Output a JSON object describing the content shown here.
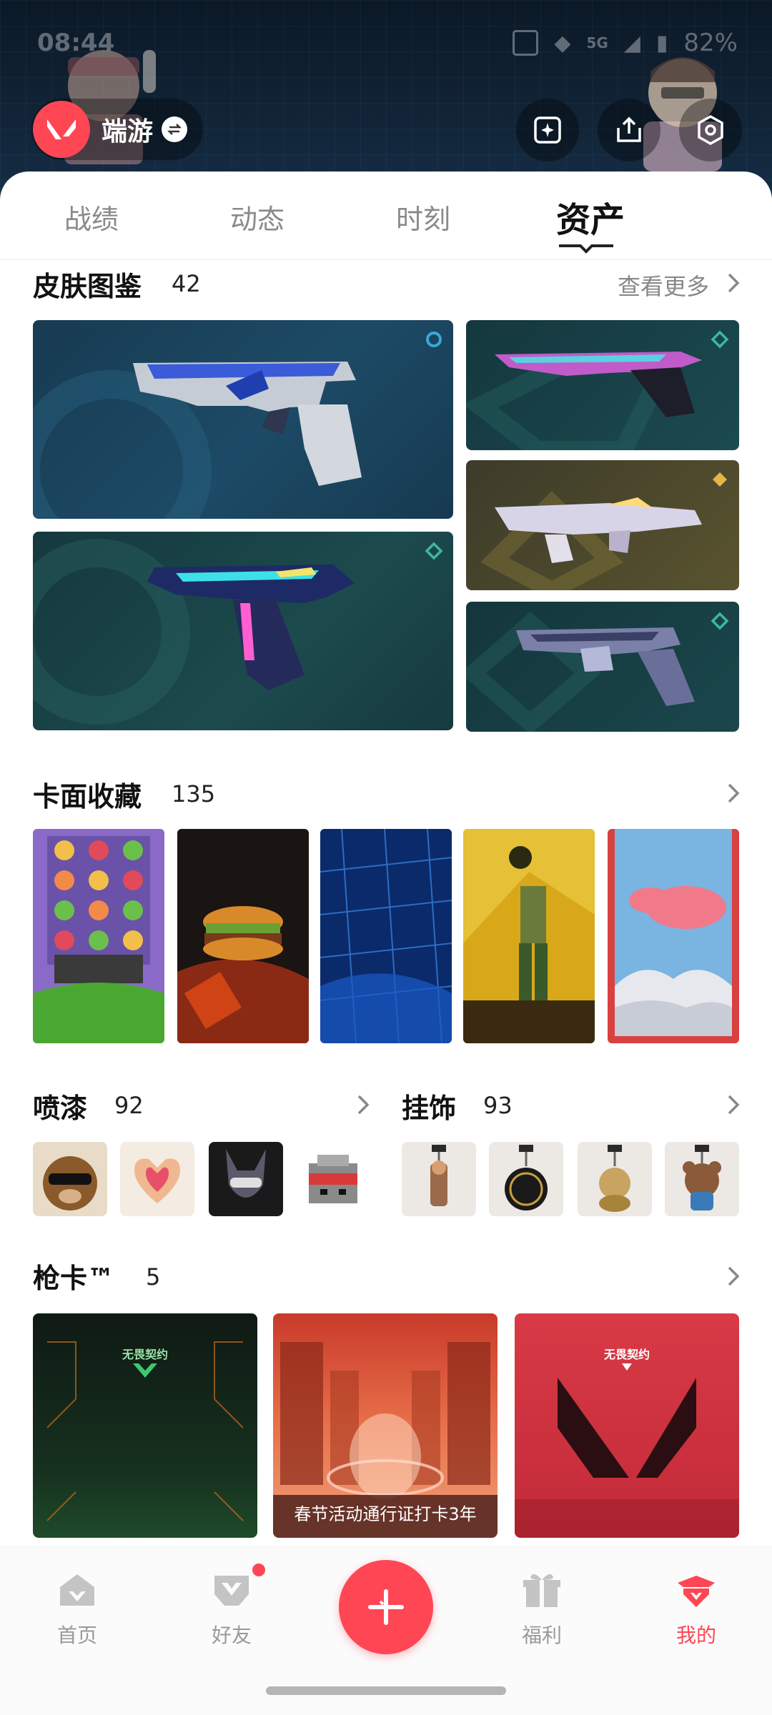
{
  "status_bar": {
    "time": "08:44",
    "network": "5G",
    "battery": "82%"
  },
  "profile": {
    "name": "端游"
  },
  "tabs": [
    {
      "label": "战绩"
    },
    {
      "label": "动态"
    },
    {
      "label": "时刻"
    },
    {
      "label": "资产"
    }
  ],
  "active_tab": "资产",
  "skins": {
    "title": "皮肤图鉴",
    "count": "42",
    "more": "查看更多"
  },
  "cards": {
    "title": "卡面收藏",
    "count": "135"
  },
  "sprays": {
    "title": "喷漆",
    "count": "92"
  },
  "charms": {
    "title": "挂饰",
    "count": "93"
  },
  "gun_cards": {
    "title": "枪卡™",
    "count": "5",
    "items": [
      {
        "brand": "无畏契约",
        "caption": ""
      },
      {
        "brand": "",
        "caption": "春节活动通行证打卡3年"
      },
      {
        "brand": "无畏契约",
        "caption": ""
      }
    ]
  },
  "bottom_nav": [
    {
      "label": "首页"
    },
    {
      "label": "好友"
    },
    {
      "label": "福利"
    },
    {
      "label": "我的"
    }
  ],
  "colors": {
    "accent": "#ff4655",
    "header_bg": "#122538"
  },
  "icons": {
    "profile_logo": "valorant-logo-icon",
    "swap": "swap-icon",
    "header_buttons": [
      "sparkle-photo-icon",
      "share-icon",
      "settings-icon"
    ],
    "fab": "plus-icon"
  }
}
